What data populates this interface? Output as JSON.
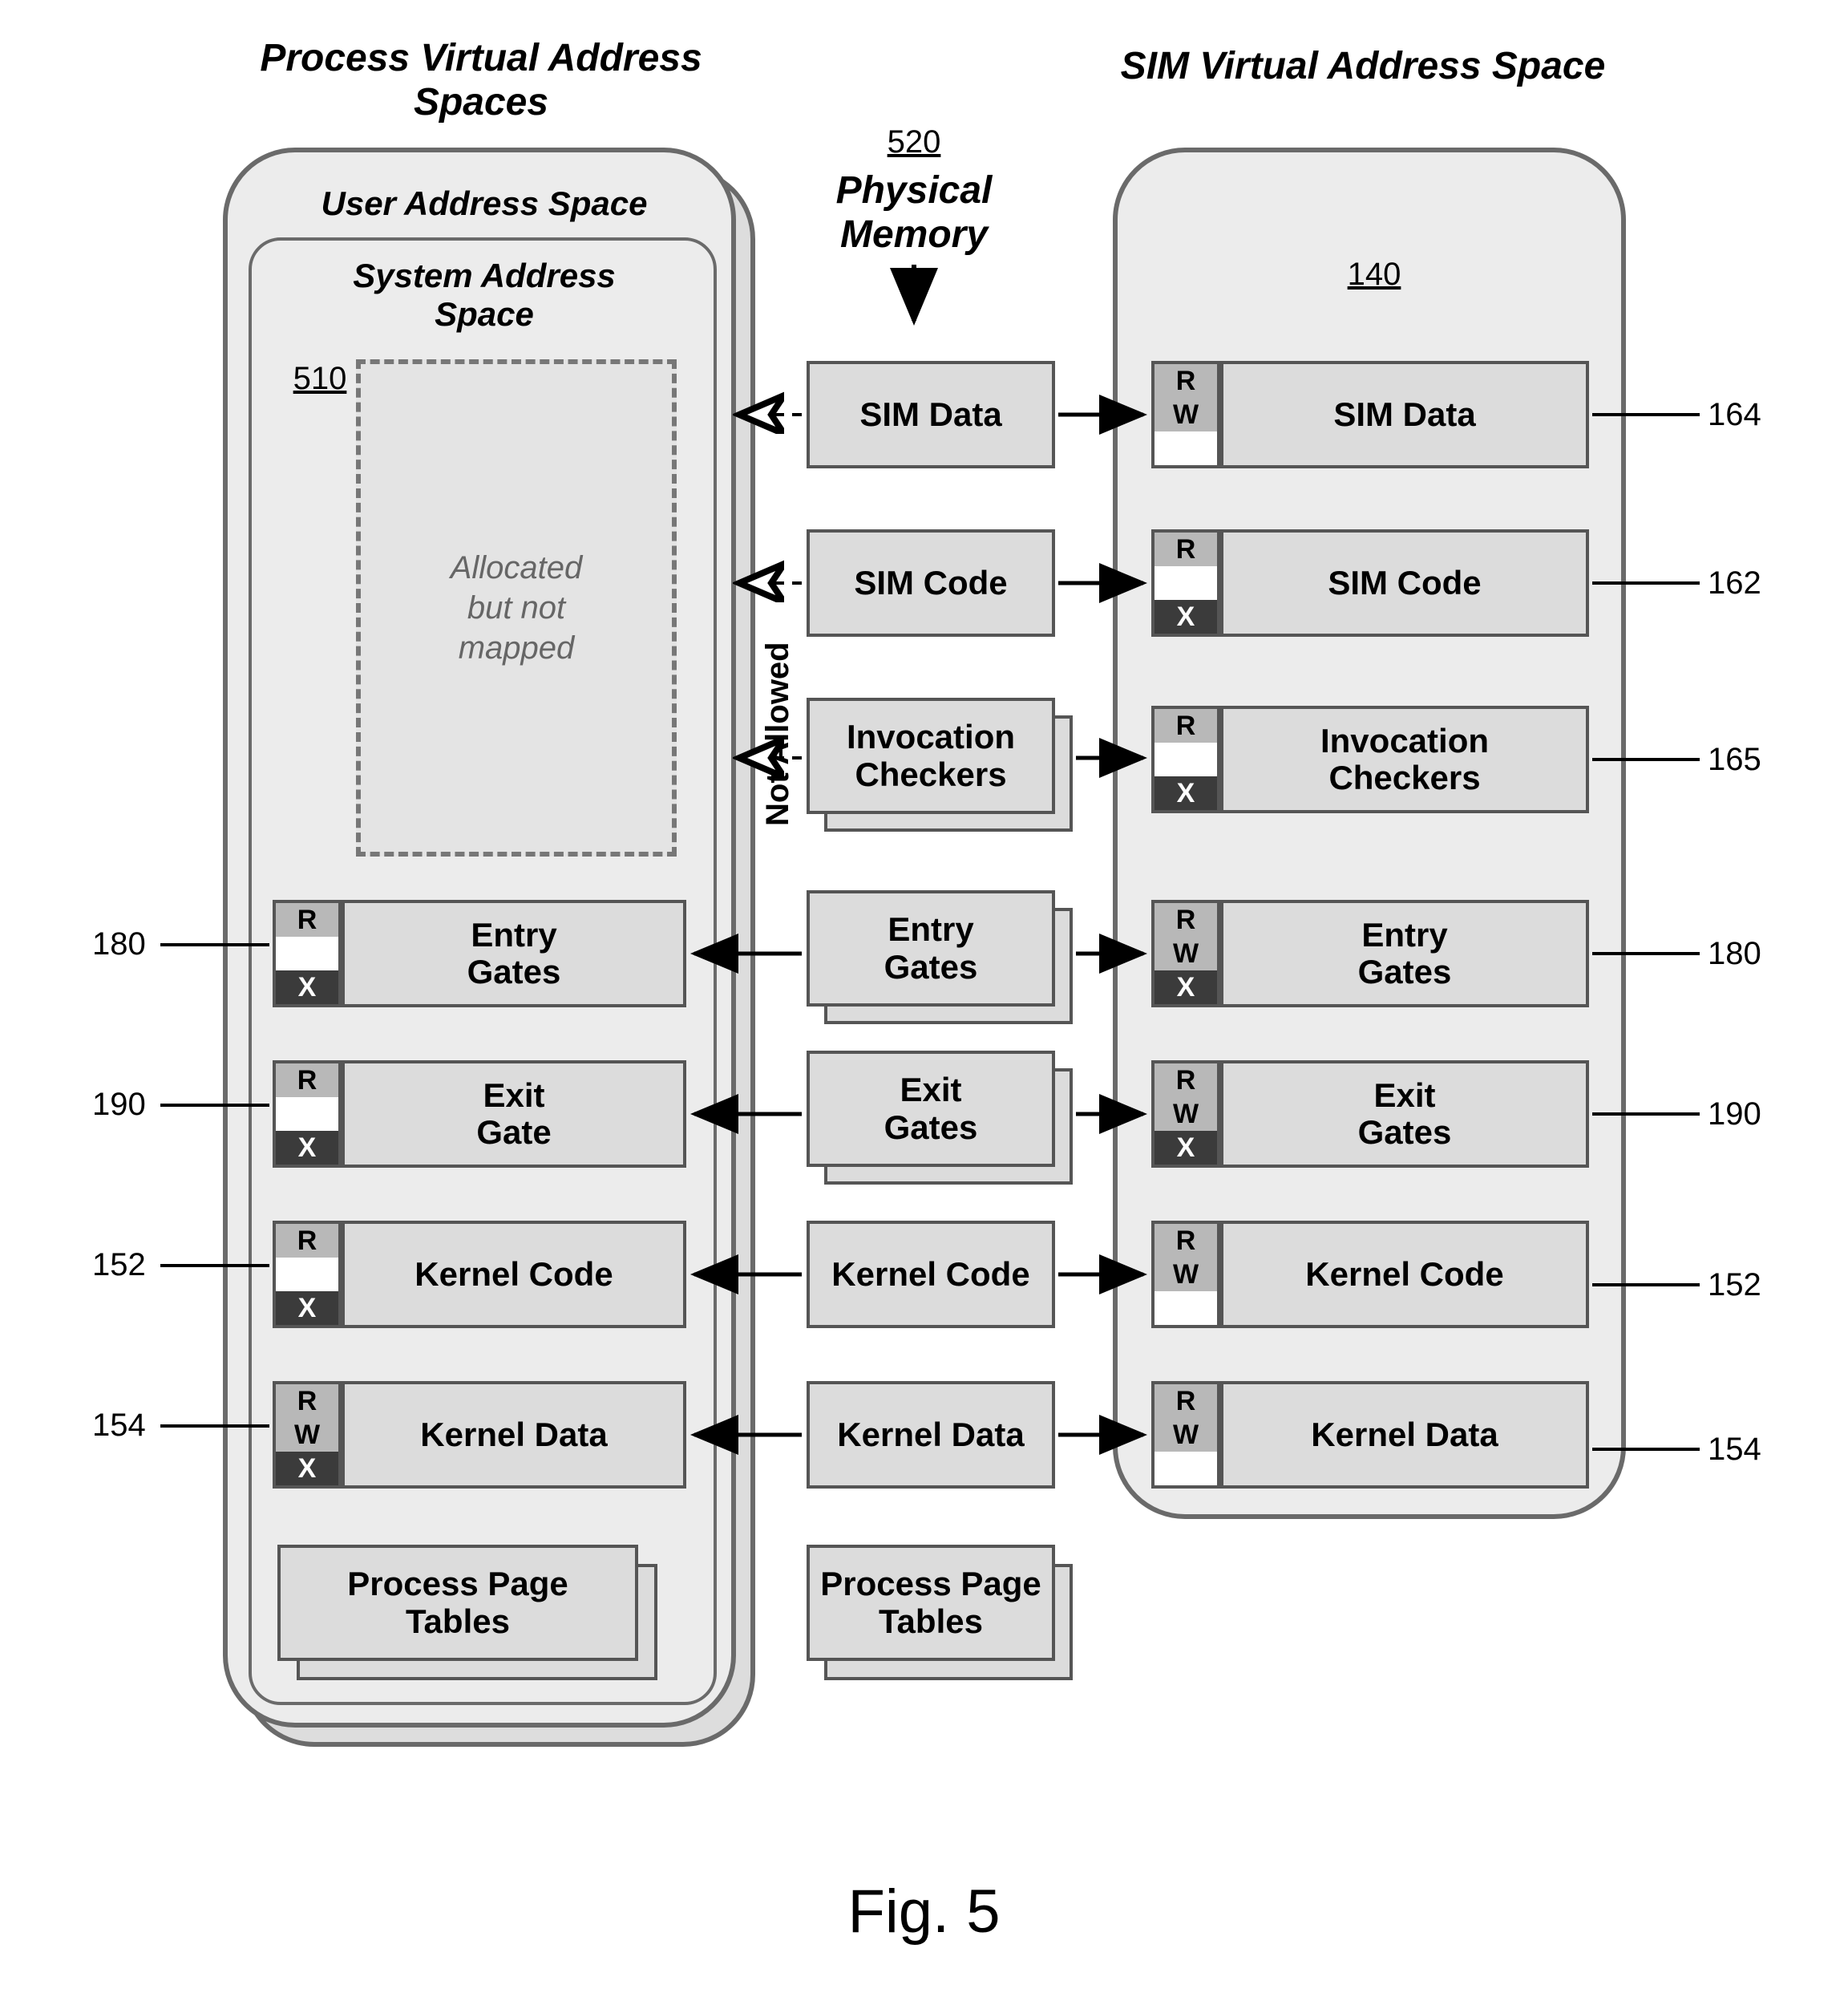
{
  "titles": {
    "left": "Process Virtual Address\nSpaces",
    "middle_num": "520",
    "middle": "Physical\nMemory",
    "right": "SIM Virtual Address Space",
    "fig": "Fig. 5"
  },
  "left_panel": {
    "user_title": "User Address Space",
    "sys_title": "System Address\nSpace",
    "ref": "510",
    "dashed": "Allocated\nbut not\nmapped",
    "boxes": {
      "entry": "Entry\nGates",
      "exit": "Exit\nGate",
      "kcode": "Kernel Code",
      "kdata": "Kernel Data",
      "ppt": "Process Page\nTables"
    }
  },
  "middle_panel": {
    "not_allowed": "Not Allowed",
    "boxes": {
      "simdata": "SIM Data",
      "simcode": "SIM Code",
      "invchk": "Invocation\nCheckers",
      "entry": "Entry\nGates",
      "exit": "Exit\nGates",
      "kcode": "Kernel Code",
      "kdata": "Kernel Data",
      "ppt": "Process Page\nTables"
    }
  },
  "right_panel": {
    "ref": "140",
    "boxes": {
      "simdata": "SIM Data",
      "simcode": "SIM Code",
      "invchk": "Invocation\nCheckers",
      "entry": "Entry\nGates",
      "exit": "Exit\nGates",
      "kcode": "Kernel Code",
      "kdata": "Kernel Data"
    }
  },
  "perms": {
    "R": "R",
    "W": "W",
    "X": "X"
  },
  "refs": {
    "r164": "164",
    "r162": "162",
    "r165": "165",
    "r180": "180",
    "r190": "190",
    "r152": "152",
    "r154": "154"
  }
}
